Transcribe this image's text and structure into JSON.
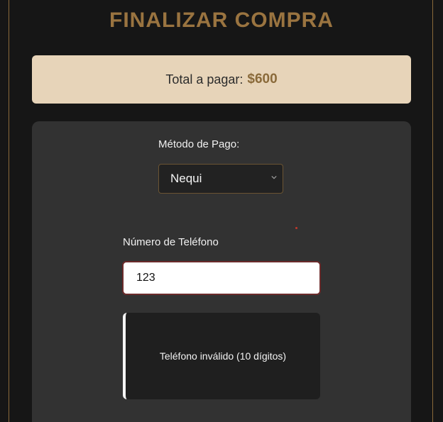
{
  "checkout": {
    "title": "FINALIZAR COMPRA",
    "total_label": "Total a pagar:",
    "total_amount": "$600"
  },
  "payment": {
    "method_label": "Método de Pago:",
    "selected_method": "Nequi",
    "chevron_icon": "chevron-down-icon"
  },
  "phone": {
    "label": "Número de Teléfono",
    "value": "123"
  },
  "error": {
    "message": "Teléfono inválido (10 dígitos)"
  },
  "colors": {
    "background": "#161616",
    "accent": "#9a7440",
    "total_box": "#e7d4b9",
    "card": "#323232"
  }
}
